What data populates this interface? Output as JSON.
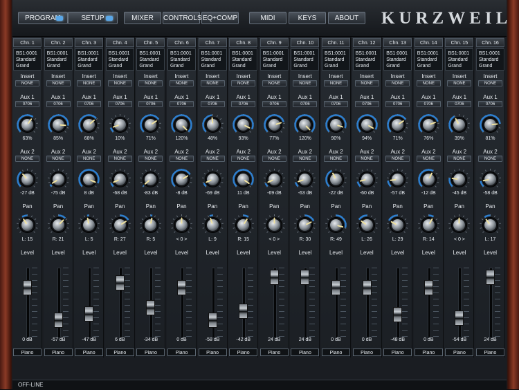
{
  "nav": [
    {
      "label": "PROGRAM",
      "indicator": true
    },
    {
      "label": "SETUP",
      "indicator": true
    },
    {
      "label": "MIXER",
      "indicator": false
    },
    {
      "label": "CONTROLS",
      "indicator": false
    },
    {
      "label": "EQ+COMP",
      "indicator": false
    },
    {
      "label": "MIDI",
      "indicator": false
    },
    {
      "label": "KEYS",
      "indicator": false
    },
    {
      "label": "ABOUT",
      "indicator": false
    }
  ],
  "brand": "KURZWEIL",
  "labels": {
    "insert": "Insert",
    "aux1": "Aux 1",
    "aux2": "Aux 2",
    "pan": "Pan",
    "level": "Level"
  },
  "channels": [
    {
      "name": "Chn. 1",
      "program": [
        "BS1:0001",
        "Standard",
        "Grand"
      ],
      "insert": "NONE",
      "aux1_src": "0706",
      "aux1": "63%",
      "aux1_level": 0.63,
      "aux2_src": "NONE",
      "aux2": "-27 dB",
      "aux2_level": 0.35,
      "pan": "L: 15",
      "pan_pos": -0.24,
      "level_db": "0 dB",
      "fader": 0.79,
      "instrument": "Piano"
    },
    {
      "name": "Chn. 2",
      "program": [
        "BS1:0001",
        "Standard",
        "Grand"
      ],
      "insert": "NONE",
      "aux1_src": "0706",
      "aux1": "85%",
      "aux1_level": 0.85,
      "aux2_src": "NONE",
      "aux2": "-75 dB",
      "aux2_level": 0.05,
      "pan": "R: 21",
      "pan_pos": 0.33,
      "level_db": "-57 dB",
      "fader": 0.25,
      "instrument": "Piano"
    },
    {
      "name": "Chn. 3",
      "program": [
        "BS1:0001",
        "Standard",
        "Grand"
      ],
      "insert": "NONE",
      "aux1_src": "0706",
      "aux1": "68%",
      "aux1_level": 0.68,
      "aux2_src": "NONE",
      "aux2": "8 dB",
      "aux2_level": 0.92,
      "pan": "L: 5",
      "pan_pos": -0.08,
      "level_db": "-47 dB",
      "fader": 0.35,
      "instrument": "Piano"
    },
    {
      "name": "Chn. 4",
      "program": [
        "BS1:0001",
        "Standard",
        "Grand"
      ],
      "insert": "NONE",
      "aux1_src": "0706",
      "aux1": "10%",
      "aux1_level": 0.1,
      "aux2_src": "NONE",
      "aux2": "-68 dB",
      "aux2_level": 0.08,
      "pan": "R: 27",
      "pan_pos": 0.43,
      "level_db": "6 dB",
      "fader": 0.87,
      "instrument": "Piano"
    },
    {
      "name": "Chn. 5",
      "program": [
        "BS1:0001",
        "Standard",
        "Grand"
      ],
      "insert": "NONE",
      "aux1_src": "0706",
      "aux1": "71%",
      "aux1_level": 0.71,
      "aux2_src": "NONE",
      "aux2": "-83 dB",
      "aux2_level": 0.02,
      "pan": "R: 5",
      "pan_pos": 0.08,
      "level_db": "-34 dB",
      "fader": 0.45,
      "instrument": "Piano"
    },
    {
      "name": "Chn. 6",
      "program": [
        "BS1:0001",
        "Standard",
        "Grand"
      ],
      "insert": "NONE",
      "aux1_src": "0706",
      "aux1": "120%",
      "aux1_level": 1.0,
      "aux2_src": "NONE",
      "aux2": "-8 dB",
      "aux2_level": 0.72,
      "pan": "< 0 >",
      "pan_pos": 0.0,
      "level_db": "0 dB",
      "fader": 0.79,
      "instrument": "Piano"
    },
    {
      "name": "Chn. 7",
      "program": [
        "BS1:0001",
        "Standard",
        "Grand"
      ],
      "insert": "NONE",
      "aux1_src": "0706",
      "aux1": "48%",
      "aux1_level": 0.48,
      "aux2_src": "NONE",
      "aux2": "-69 dB",
      "aux2_level": 0.08,
      "pan": "L: 9",
      "pan_pos": -0.14,
      "level_db": "-58 dB",
      "fader": 0.24,
      "instrument": "Piano"
    },
    {
      "name": "Chn. 8",
      "program": [
        "BS1:0001",
        "Standard",
        "Grand"
      ],
      "insert": "NONE",
      "aux1_src": "0706",
      "aux1": "93%",
      "aux1_level": 0.93,
      "aux2_src": "NONE",
      "aux2": "11 dB",
      "aux2_level": 0.96,
      "pan": "R: 15",
      "pan_pos": 0.24,
      "level_db": "-42 dB",
      "fader": 0.4,
      "instrument": "Piano"
    },
    {
      "name": "Chn. 9",
      "program": [
        "BS1:0001",
        "Standard",
        "Grand"
      ],
      "insert": "NONE",
      "aux1_src": "0706",
      "aux1": "77%",
      "aux1_level": 0.77,
      "aux2_src": "NONE",
      "aux2": "-69 dB",
      "aux2_level": 0.08,
      "pan": "< 0 >",
      "pan_pos": 0.0,
      "level_db": "24 dB",
      "fader": 0.97,
      "instrument": "Piano"
    },
    {
      "name": "Chn. 10",
      "program": [
        "BS1:0001",
        "Standard",
        "Grand"
      ],
      "insert": "NONE",
      "aux1_src": "0706",
      "aux1": "120%",
      "aux1_level": 1.0,
      "aux2_src": "NONE",
      "aux2": "-63 dB",
      "aux2_level": 0.1,
      "pan": "R: 30",
      "pan_pos": 0.48,
      "level_db": "24 dB",
      "fader": 0.97,
      "instrument": "Piano"
    },
    {
      "name": "Chn. 11",
      "program": [
        "BS1:0001",
        "Standard",
        "Grand"
      ],
      "insert": "NONE",
      "aux1_src": "0706",
      "aux1": "90%",
      "aux1_level": 0.9,
      "aux2_src": "NONE",
      "aux2": "-22 dB",
      "aux2_level": 0.4,
      "pan": "R: 49",
      "pan_pos": 0.78,
      "level_db": "0 dB",
      "fader": 0.79,
      "instrument": "Piano"
    },
    {
      "name": "Chn. 12",
      "program": [
        "BS1:0001",
        "Standard",
        "Grand"
      ],
      "insert": "NONE",
      "aux1_src": "0706",
      "aux1": "94%",
      "aux1_level": 0.94,
      "aux2_src": "NONE",
      "aux2": "-60 dB",
      "aux2_level": 0.12,
      "pan": "L: 26",
      "pan_pos": -0.41,
      "level_db": "0 dB",
      "fader": 0.79,
      "instrument": "Piano"
    },
    {
      "name": "Chn. 13",
      "program": [
        "BS1:0001",
        "Standard",
        "Grand"
      ],
      "insert": "NONE",
      "aux1_src": "0706",
      "aux1": "71%",
      "aux1_level": 0.71,
      "aux2_src": "NONE",
      "aux2": "-57 dB",
      "aux2_level": 0.14,
      "pan": "L: 29",
      "pan_pos": -0.46,
      "level_db": "-48 dB",
      "fader": 0.34,
      "instrument": "Piano"
    },
    {
      "name": "Chn. 14",
      "program": [
        "BS1:0001",
        "Standard",
        "Grand"
      ],
      "insert": "NONE",
      "aux1_src": "0706",
      "aux1": "76%",
      "aux1_level": 0.76,
      "aux2_src": "NONE",
      "aux2": "-12 dB",
      "aux2_level": 0.6,
      "pan": "R: 14",
      "pan_pos": 0.22,
      "level_db": "0 dB",
      "fader": 0.79,
      "instrument": "Piano"
    },
    {
      "name": "Chn. 15",
      "program": [
        "BS1:0001",
        "Standard",
        "Grand"
      ],
      "insert": "NONE",
      "aux1_src": "0706",
      "aux1": "39%",
      "aux1_level": 0.39,
      "aux2_src": "NONE",
      "aux2": "-45 dB",
      "aux2_level": 0.2,
      "pan": "< 0 >",
      "pan_pos": 0.0,
      "level_db": "-54 dB",
      "fader": 0.28,
      "instrument": "Piano"
    },
    {
      "name": "Chn. 16",
      "program": [
        "BS1:0001",
        "Standard",
        "Grand"
      ],
      "insert": "NONE",
      "aux1_src": "0706",
      "aux1": "81%",
      "aux1_level": 0.81,
      "aux2_src": "NONE",
      "aux2": "-58 dB",
      "aux2_level": 0.13,
      "pan": "L: 17",
      "pan_pos": -0.27,
      "level_db": "24 dB",
      "fader": 0.97,
      "instrument": "Piano"
    }
  ],
  "status": "OFF-LINE",
  "colors": {
    "indicator": "#5aa7e8",
    "knob_arc": "#2d7fd0",
    "knob_pointer": "#f0e2a0",
    "background": "#1a1d22"
  }
}
